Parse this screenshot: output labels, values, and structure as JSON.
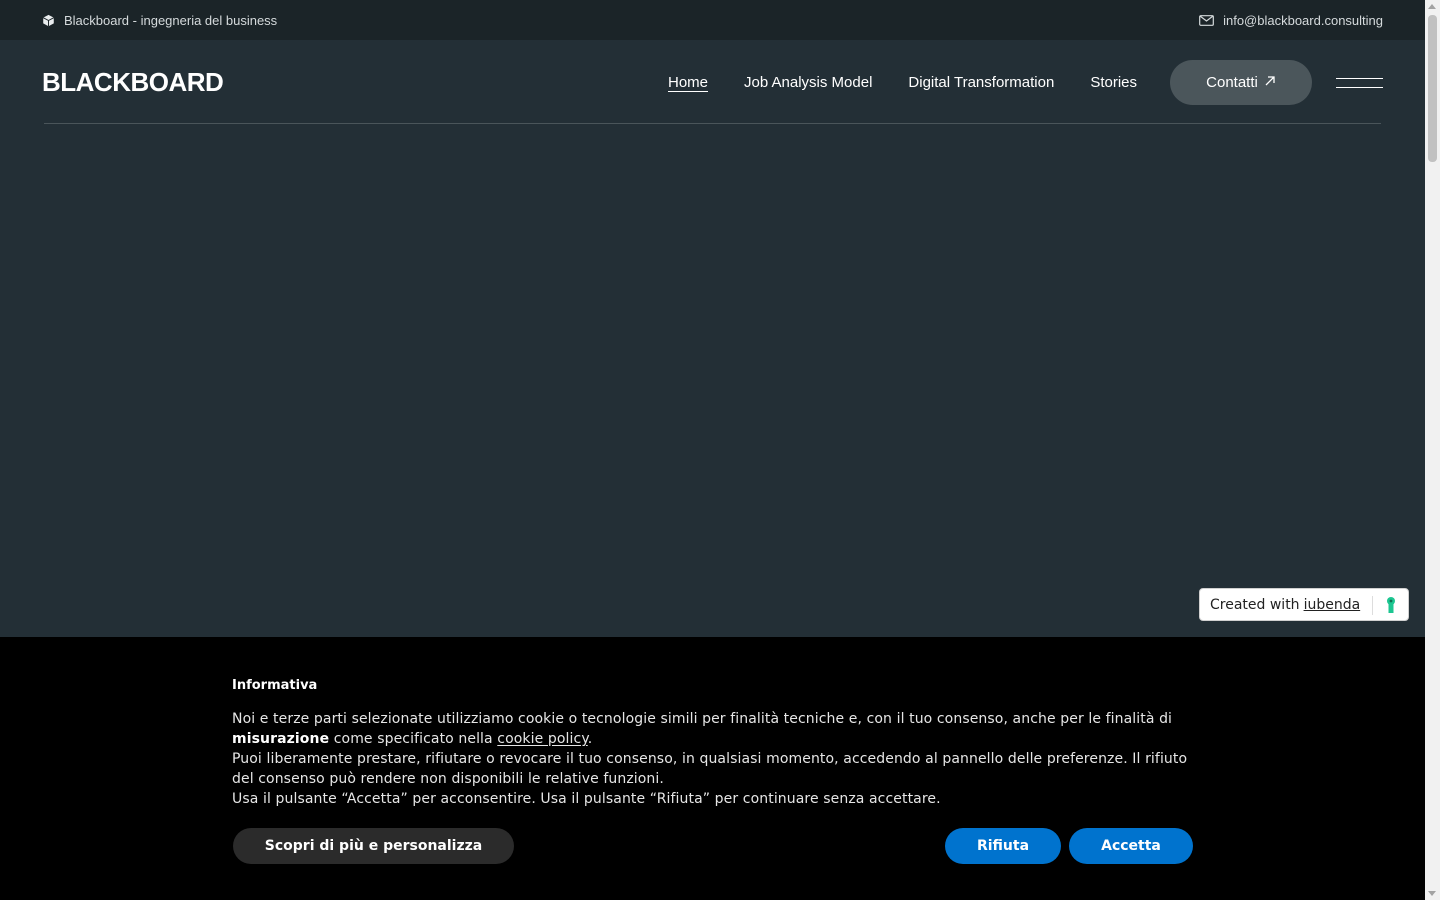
{
  "topbar": {
    "tagline": "Blackboard - ingegneria del business",
    "tagline_icon": "cube-icon",
    "email": "info@blackboard.consulting",
    "email_icon": "mail-icon"
  },
  "header": {
    "logo": "BLACKBOARD",
    "nav": [
      {
        "label": "Home",
        "active": true
      },
      {
        "label": "Job Analysis Model",
        "active": false
      },
      {
        "label": "Digital Transformation",
        "active": false
      },
      {
        "label": "Stories",
        "active": false
      }
    ],
    "contact_label": "Contatti",
    "contact_icon": "arrow-up-right-icon",
    "menu_icon": "hamburger-icon"
  },
  "iubenda": {
    "prefix": "Created with",
    "link": "iubenda",
    "icon": "keyhole-icon"
  },
  "cookie": {
    "title": "Informativa",
    "line1_a": "Noi e terze parti selezionate utilizziamo cookie o tecnologie simili per finalità tecniche e, con il tuo consenso, anche per le finalità di",
    "line1_bold": "misurazione",
    "line1_b": "come specificato nella",
    "line1_link": "cookie policy",
    "line1_end": ".",
    "line2": "Puoi liberamente prestare, rifiutare o revocare il tuo consenso, in qualsiasi momento, accedendo al pannello delle preferenze. Il rifiuto del consenso può rendere non disponibili le relative funzioni.",
    "line3": "Usa il pulsante “Accetta” per acconsentire. Usa il pulsante “Rifiuta” per continuare senza accettare.",
    "btn_customize": "Scopri di più e personalizza",
    "btn_reject": "Rifiuta",
    "btn_accept": "Accetta"
  },
  "colors": {
    "page_bg": "#232f36",
    "topbar_bg": "#1b2428",
    "contact_bg": "#4b565b",
    "banner_bg": "#000000",
    "primary_button": "#0073ce",
    "iubenda_green": "#1cc691"
  }
}
